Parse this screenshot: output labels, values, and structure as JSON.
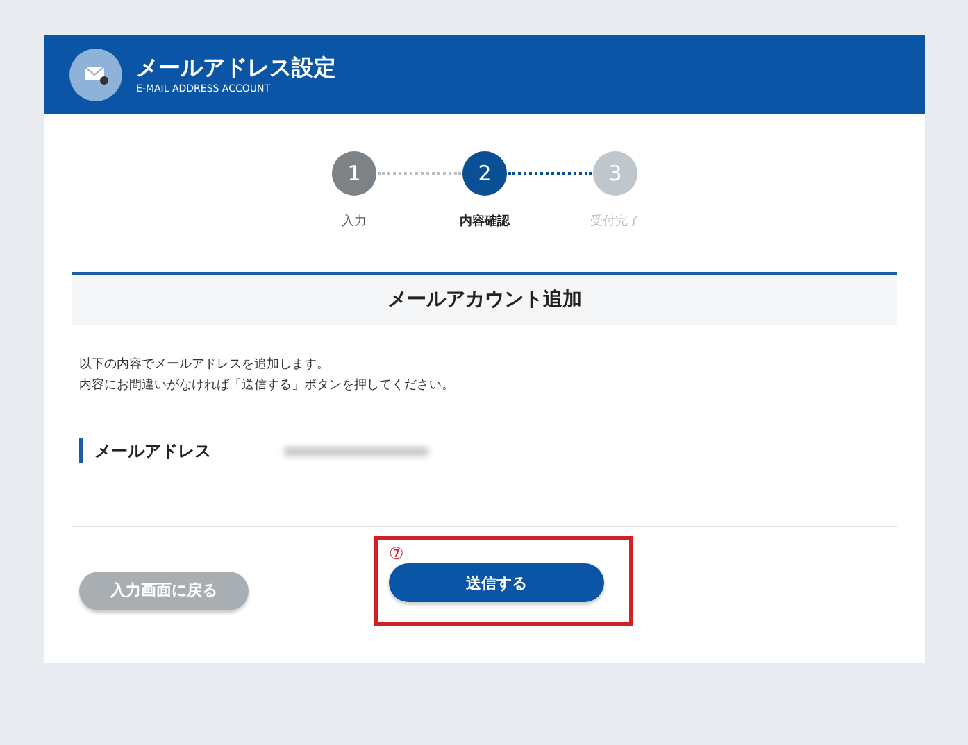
{
  "header": {
    "title": "メールアドレス設定",
    "subtitle": "E-MAIL ADDRESS ACCOUNT"
  },
  "steps": [
    {
      "number": "1",
      "label": "入力",
      "kind": "done"
    },
    {
      "number": "2",
      "label": "内容確認",
      "kind": "current"
    },
    {
      "number": "3",
      "label": "受付完了",
      "kind": "upcoming"
    }
  ],
  "section_title": "メールアカウント追加",
  "message": [
    "以下の内容でメールアドレスを追加します。",
    "内容にお間違いがなければ「送信する」ボタンを押してください。"
  ],
  "field": {
    "label": "メールアドレス",
    "value_redacted": true
  },
  "buttons": [
    {
      "label": "入力画面に戻る",
      "kind": "secondary"
    },
    {
      "label": "送信する",
      "kind": "primary",
      "annotation": "⑦"
    }
  ]
}
